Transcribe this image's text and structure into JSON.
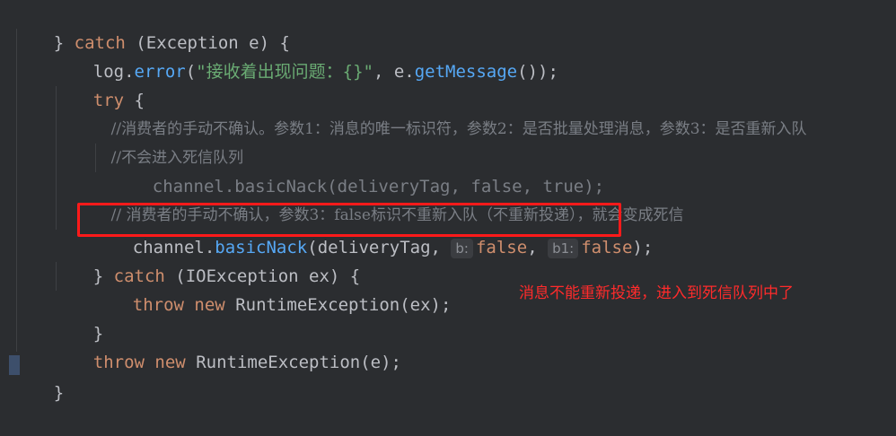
{
  "code": {
    "l1": {
      "a": "} ",
      "b": "catch",
      "c": " (",
      "d": "Exception",
      "e": " e) {"
    },
    "l2": {
      "a": "log",
      "b": ".",
      "c": "error",
      "d": "(",
      "e": "\"接收着出现问题：{}\"",
      "f": ", e.",
      "g": "getMessage",
      "h": "());"
    },
    "l3": {
      "a": "try",
      "b": " {"
    },
    "l4": {
      "a": "//消费者的手动不确认。参数1：消息的唯一标识符，参数2：是否批量处理消息，参数3：是否重新入队"
    },
    "l5": {
      "a": "//不会进入死信队列"
    },
    "l6": {
      "a": "channel.basicNack(deliveryTag, false, true);"
    },
    "l7": {
      "a": "// 消费者的手动不确认，参数3：false标识不重新入队（不重新投递），就会变成死信"
    },
    "l8": {
      "a": "channel",
      "b": ".",
      "c": "basicNack",
      "d": "(deliveryTag, ",
      "hint1": "b:",
      "e": "false",
      "f": ", ",
      "hint2": "b1:",
      "g": "false",
      "h": ");"
    },
    "l9": {
      "a": "} ",
      "b": "catch",
      "c": " (IOException ex) {"
    },
    "l10": {
      "a": "throw",
      "b": " ",
      "c": "new",
      "d": " RuntimeException(ex);"
    },
    "l11": {
      "a": "}"
    },
    "l12": {
      "a": "throw",
      "b": " ",
      "c": "new",
      "d": " RuntimeException(e);"
    },
    "l13": {
      "a": "}"
    }
  },
  "annotation": {
    "text": "消息不能重新投递，进入到死信队列中了",
    "color": "#ff2b2b"
  }
}
